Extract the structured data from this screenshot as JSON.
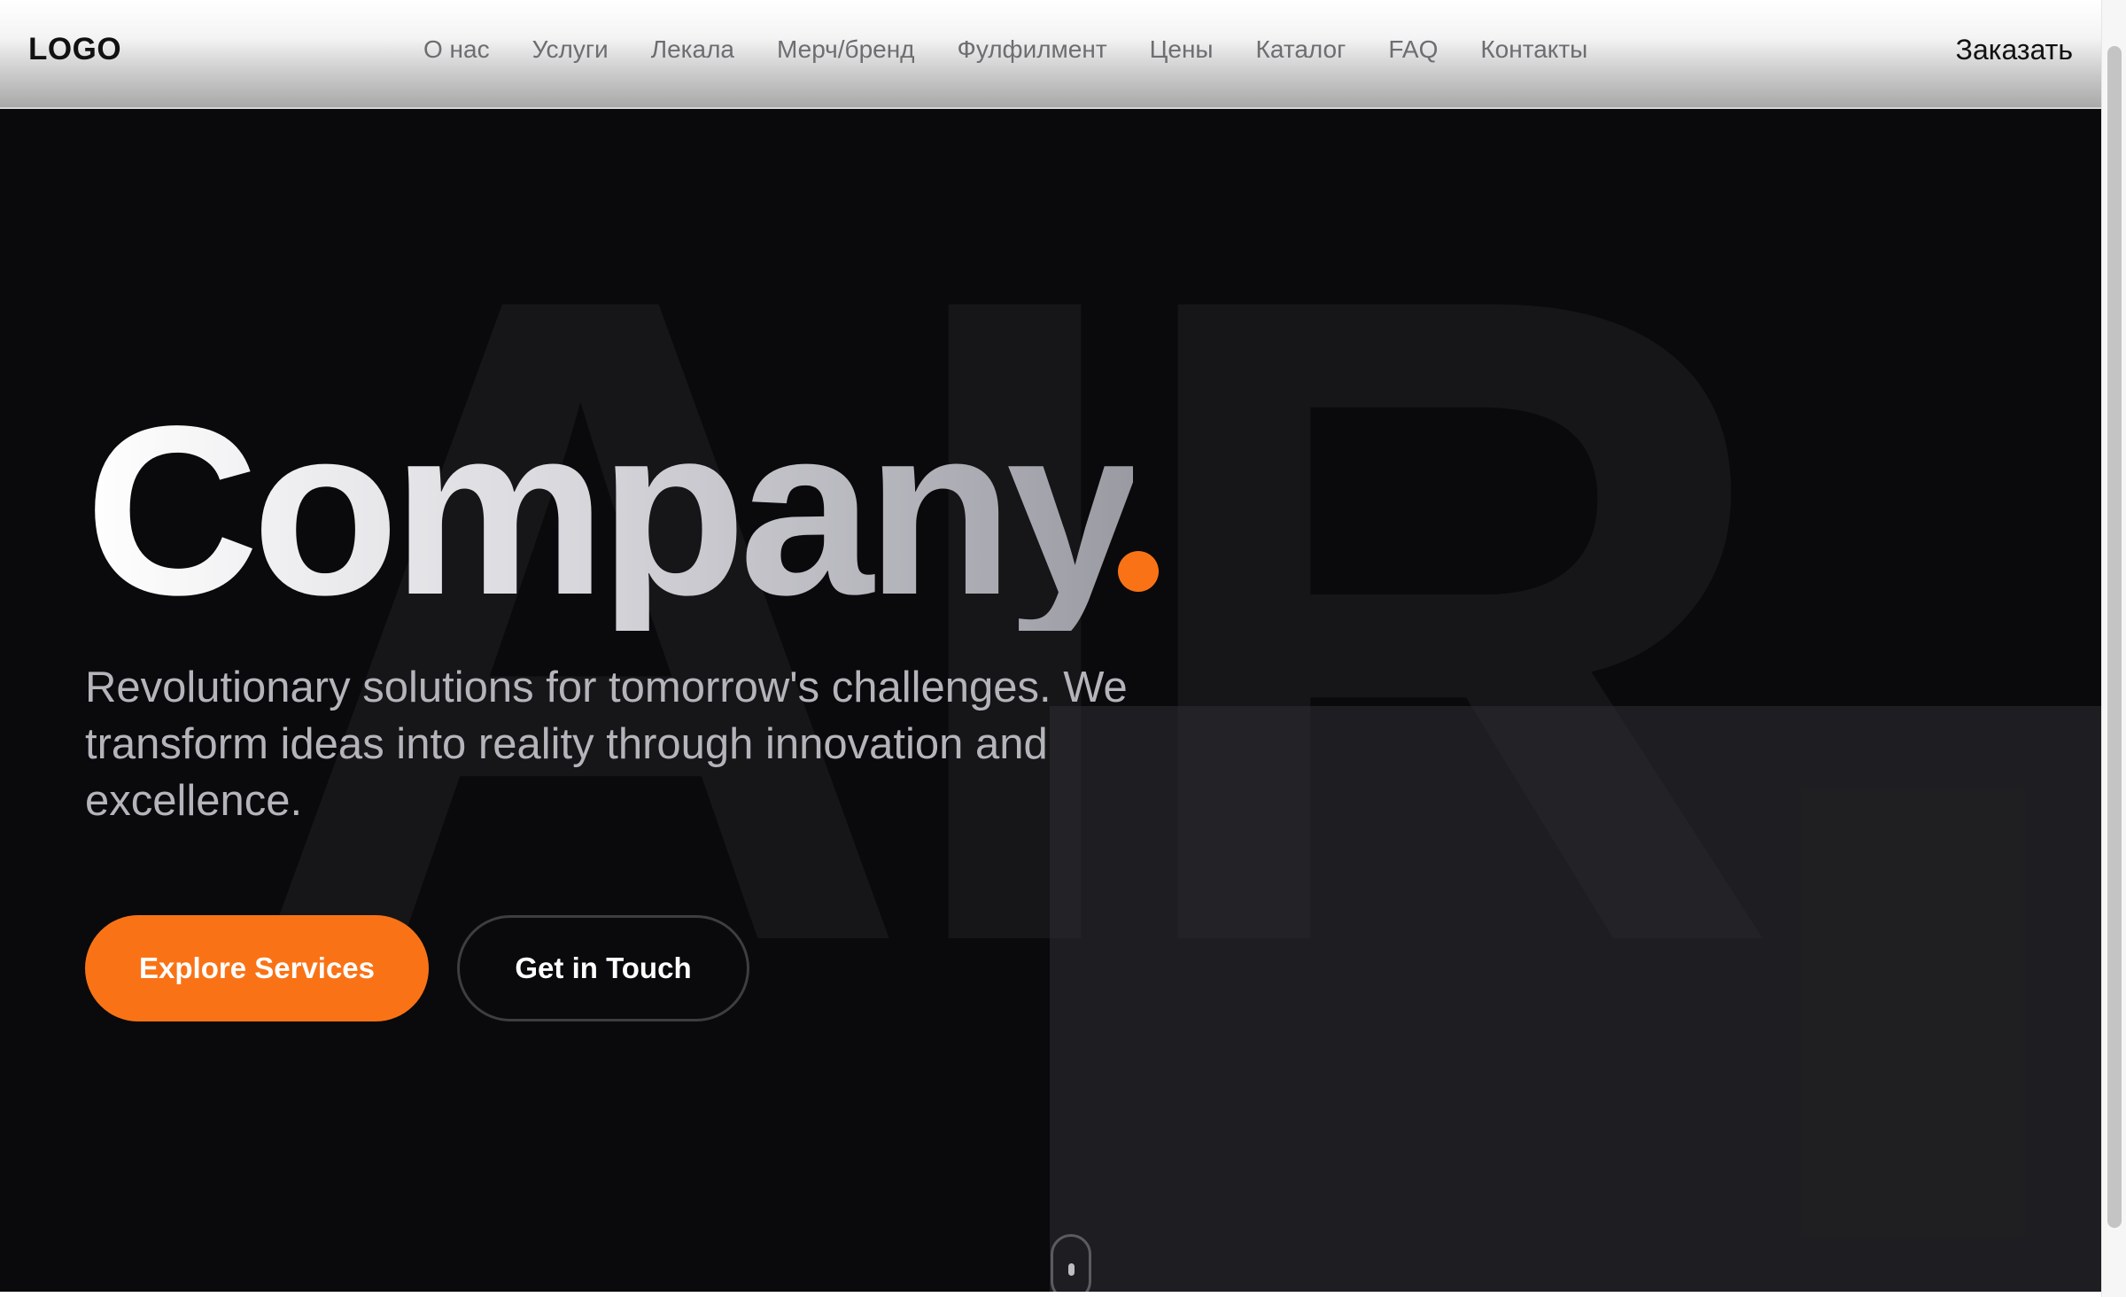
{
  "header": {
    "logo": "LOGO",
    "nav": [
      "О нас",
      "Услуги",
      "Лекала",
      "Мерч/бренд",
      "Фулфилмент",
      "Цены",
      "Каталог",
      "FAQ",
      "Контакты"
    ],
    "order_label": "Заказать"
  },
  "background": {
    "letters": "AIR"
  },
  "hero": {
    "title": "Company",
    "subtitle": "Revolutionary solutions for tomorrow's challenges. We transform ideas into reality through innovation and excellence.",
    "primary_button": "Explore Services",
    "secondary_button": "Get in Touch"
  },
  "colors": {
    "accent": "#f97316",
    "background": "#0a0a0c",
    "text_muted": "#b4b4bb"
  },
  "icons": {
    "scroll_indicator": "mouse-scroll-icon"
  }
}
